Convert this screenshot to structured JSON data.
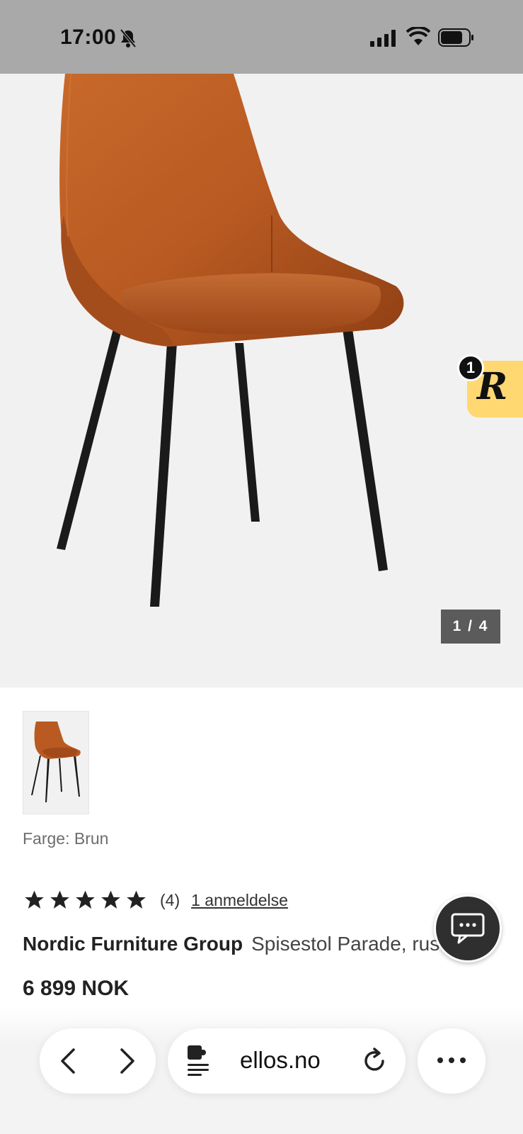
{
  "status_bar": {
    "time": "17:00"
  },
  "gallery": {
    "counter": "1 / 4",
    "current": 1,
    "total": 4
  },
  "badge": {
    "letter": "R",
    "count": "1",
    "color": "#ffd872"
  },
  "product": {
    "color_label": "Farge: Brun",
    "rating": 5,
    "rating_count": "(4)",
    "review_link": "1 anmeldelse",
    "brand": "Nordic Furniture Group",
    "name": "Spisestol Parade, rust",
    "price": "6 899 NOK"
  },
  "browser": {
    "url": "ellos.no"
  },
  "colors": {
    "status_bar": "#a9a9a9",
    "hero_bg": "#f2f1f1",
    "chair_velvet": "#b85a22",
    "chair_legs": "#1a1a1a"
  }
}
